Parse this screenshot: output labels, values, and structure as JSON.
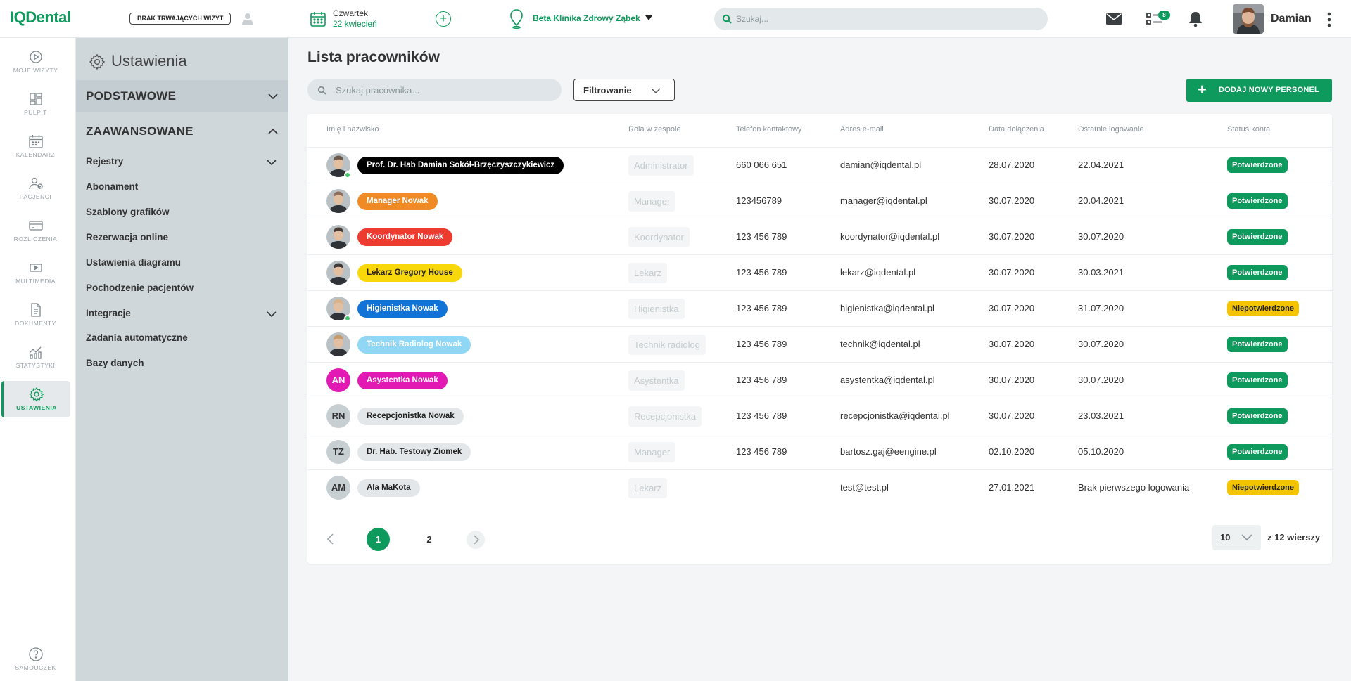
{
  "app": {
    "logo": "IQDental"
  },
  "header": {
    "visit_status": "BRAK TRWAJĄCYCH WIZYT",
    "day": "Czwartek",
    "date": "22 kwiecień",
    "clinic": "Beta Klinika Zdrowy Ząbek",
    "search_placeholder": "Szukaj...",
    "tasks_badge": "8",
    "username": "Damian"
  },
  "nav": {
    "items": [
      {
        "label": "MOJE WIZYTY",
        "icon": "play-circle-icon"
      },
      {
        "label": "PULPIT",
        "icon": "dashboard-icon"
      },
      {
        "label": "KALENDARZ",
        "icon": "calendar-icon"
      },
      {
        "label": "PACJENCI",
        "icon": "patients-icon"
      },
      {
        "label": "ROZLICZENIA",
        "icon": "card-icon"
      },
      {
        "label": "MULTIMEDIA",
        "icon": "media-icon"
      },
      {
        "label": "DOKUMENTY",
        "icon": "document-icon"
      },
      {
        "label": "STATYSTYKI",
        "icon": "stats-icon"
      },
      {
        "label": "USTAWIENIA",
        "icon": "gear-icon"
      }
    ],
    "help": "SAMOUCZEK"
  },
  "settings": {
    "title": "Ustawienia",
    "sections": [
      "PODSTAWOWE",
      "ZAAWANSOWANE"
    ],
    "items": [
      "Rejestry",
      "Abonament",
      "Szablony grafików",
      "Rezerwacja online",
      "Ustawienia diagramu",
      "Pochodzenie pacjentów",
      "Integracje",
      "Zadania automatyczne",
      "Bazy danych"
    ]
  },
  "main": {
    "title": "Lista pracowników",
    "search_placeholder": "Szukaj pracownika...",
    "filter_label": "Filtrowanie",
    "add_button": "DODAJ NOWY PERSONEL",
    "columns": [
      "Imię i nazwisko",
      "Rola w zespole",
      "Telefon kontaktowy",
      "Adres e-mail",
      "Data dołączenia",
      "Ostatnie logowanie",
      "Status konta"
    ],
    "rows": [
      {
        "initials": "",
        "name": "Prof. Dr. Hab Damian Sokół-Brzęczyszczykiewicz",
        "tag_color": "#000000",
        "text_color": "#ffffff",
        "role": "Administrator",
        "phone": "660 066 651",
        "email": "damian@iqdental.pl",
        "joined": "28.07.2020",
        "last_login": "22.04.2021",
        "status": "Potwierdzone",
        "status_type": "ok",
        "online": true
      },
      {
        "initials": "",
        "name": "Manager Nowak",
        "tag_color": "#f08a24",
        "text_color": "#ffffff",
        "role": "Manager",
        "phone": "123456789",
        "email": "manager@iqdental.pl",
        "joined": "30.07.2020",
        "last_login": "20.04.2021",
        "status": "Potwierdzone",
        "status_type": "ok",
        "online": false
      },
      {
        "initials": "",
        "name": "Koordynator Nowak",
        "tag_color": "#ee3b30",
        "text_color": "#ffffff",
        "role": "Koordynator",
        "phone": "123 456 789",
        "email": "koordynator@iqdental.pl",
        "joined": "30.07.2020",
        "last_login": "30.07.2020",
        "status": "Potwierdzone",
        "status_type": "ok",
        "online": false
      },
      {
        "initials": "",
        "name": "Lekarz Gregory House",
        "tag_color": "#f8d80a",
        "text_color": "#222222",
        "role": "Lekarz",
        "phone": "123 456 789",
        "email": "lekarz@iqdental.pl",
        "joined": "30.07.2020",
        "last_login": "30.03.2021",
        "status": "Potwierdzone",
        "status_type": "ok",
        "online": false
      },
      {
        "initials": "",
        "name": "Higienistka Nowak",
        "tag_color": "#1273d6",
        "text_color": "#ffffff",
        "role": "Higienistka",
        "phone": "123 456 789",
        "email": "higienistka@iqdental.pl",
        "joined": "30.07.2020",
        "last_login": "31.07.2020",
        "status": "Niepotwierdzone",
        "status_type": "warn",
        "online": true
      },
      {
        "initials": "",
        "name": "Technik Radiolog Nowak",
        "tag_color": "#8fd7f5",
        "text_color": "#ffffff",
        "role": "Technik radiolog",
        "phone": "123 456 789",
        "email": "technik@iqdental.pl",
        "joined": "30.07.2020",
        "last_login": "30.07.2020",
        "status": "Potwierdzone",
        "status_type": "ok",
        "online": false
      },
      {
        "initials": "AN",
        "name": "Asystentka Nowak",
        "tag_color": "#e319b4",
        "text_color": "#ffffff",
        "role": "Asystentka",
        "phone": "123 456 789",
        "email": "asystentka@iqdental.pl",
        "joined": "30.07.2020",
        "last_login": "30.07.2020",
        "status": "Potwierdzone",
        "status_type": "ok",
        "online": false
      },
      {
        "initials": "RN",
        "name": "Recepcjonistka Nowak",
        "tag_color": "#e3e7e9",
        "text_color": "#222222",
        "role": "Recepcjonistka",
        "phone": "123 456 789",
        "email": "recepcjonistka@iqdental.pl",
        "joined": "30.07.2020",
        "last_login": "23.03.2021",
        "status": "Potwierdzone",
        "status_type": "ok",
        "online": false
      },
      {
        "initials": "TZ",
        "name": "Dr. Hab. Testowy Ziomek",
        "tag_color": "#e3e7e9",
        "text_color": "#222222",
        "role": "Manager",
        "phone": "123 456 789",
        "email": "bartosz.gaj@eengine.pl",
        "joined": "02.10.2020",
        "last_login": "05.10.2020",
        "status": "Potwierdzone",
        "status_type": "ok",
        "online": false
      },
      {
        "initials": "AM",
        "name": "Ala MaKota",
        "tag_color": "#e3e7e9",
        "text_color": "#222222",
        "role": "Lekarz",
        "phone": "",
        "email": "test@test.pl",
        "joined": "27.01.2021",
        "last_login": "Brak pierwszego logowania",
        "status": "Niepotwierdzone",
        "status_type": "warn",
        "online": false
      }
    ],
    "pagination": {
      "current": "1",
      "next": "2"
    },
    "rows_per_page": "10",
    "rows_total": "z 12 wierszy"
  }
}
